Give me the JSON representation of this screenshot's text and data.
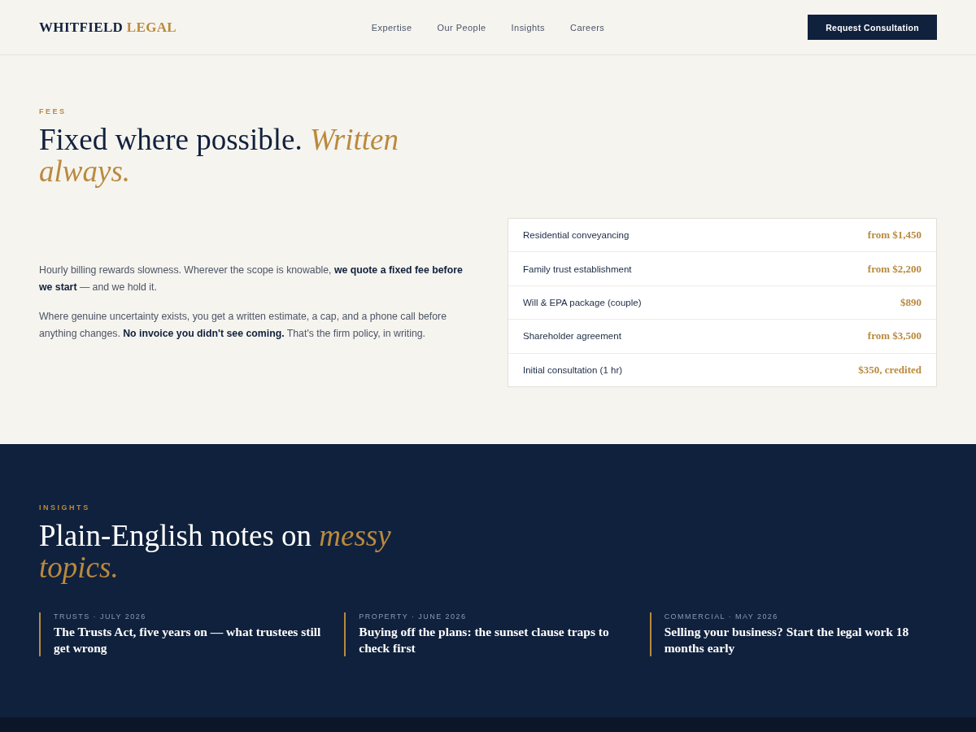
{
  "header": {
    "logo": {
      "primary": "WHITFIELD",
      "accent": "LEGAL"
    },
    "nav": [
      "Expertise",
      "Our People",
      "Insights",
      "Careers"
    ],
    "cta": "Request Consultation"
  },
  "fees": {
    "eyebrow": "FEES",
    "heading": "Fixed where possible. *Written always.*",
    "paragraphs": [
      "Hourly billing rewards slowness. Wherever the scope is knowable, **we quote a fixed fee before we start** — and we hold it.",
      "Where genuine uncertainty exists, you get a written estimate, a cap, and a phone call before anything changes. **No invoice you didn't see coming.** That's the firm policy, in writing."
    ],
    "table": [
      {
        "service": "Residential conveyancing",
        "price": "from $1,450"
      },
      {
        "service": "Family trust establishment",
        "price": "from $2,200"
      },
      {
        "service": "Will & EPA package (couple)",
        "price": "$890"
      },
      {
        "service": "Shareholder agreement",
        "price": "from $3,500"
      },
      {
        "service": "Initial consultation (1 hr)",
        "price": "$350, credited"
      }
    ]
  },
  "insights": {
    "eyebrow": "INSIGHTS",
    "heading": "Plain-English notes on *messy topics.*",
    "articles": [
      {
        "meta": "TRUSTS · JULY 2026",
        "title": "The Trusts Act, five years on — what trustees still get wrong"
      },
      {
        "meta": "PROPERTY · JUNE 2026",
        "title": "Buying off the plans: the sunset clause traps to check first"
      },
      {
        "meta": "COMMERCIAL · MAY 2026",
        "title": "Selling your business? Start the legal work 18 months early"
      }
    ]
  }
}
